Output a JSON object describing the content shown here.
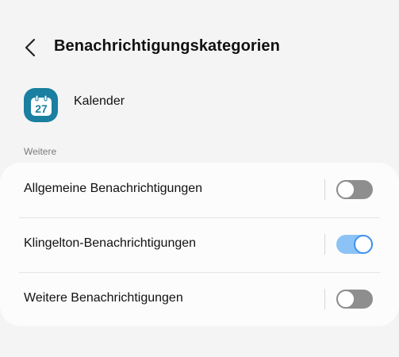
{
  "header": {
    "title": "Benachrichtigungskategorien"
  },
  "app": {
    "name": "Kalender",
    "icon": "calendar-icon",
    "icon_day": "27",
    "icon_color": "#1a7fa0"
  },
  "section": {
    "label": "Weitere"
  },
  "categories": [
    {
      "label": "Allgemeine Benachrichtigungen",
      "enabled": false
    },
    {
      "label": "Klingelton-Benachrichtigungen",
      "enabled": true
    },
    {
      "label": "Weitere Benachrichtigungen",
      "enabled": false
    }
  ],
  "colors": {
    "toggle_on_track": "#8cc3f6",
    "toggle_on_knob_border": "#3e91ea",
    "toggle_off_track": "#8e8e8e"
  }
}
